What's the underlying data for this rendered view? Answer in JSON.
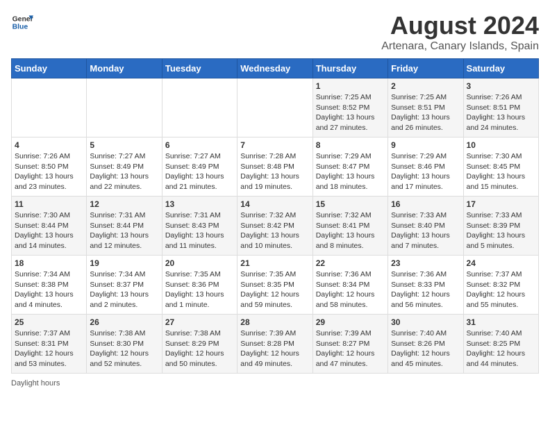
{
  "header": {
    "logo_general": "General",
    "logo_blue": "Blue",
    "main_title": "August 2024",
    "sub_title": "Artenara, Canary Islands, Spain"
  },
  "days_of_week": [
    "Sunday",
    "Monday",
    "Tuesday",
    "Wednesday",
    "Thursday",
    "Friday",
    "Saturday"
  ],
  "weeks": [
    [
      {
        "day": "",
        "info": ""
      },
      {
        "day": "",
        "info": ""
      },
      {
        "day": "",
        "info": ""
      },
      {
        "day": "",
        "info": ""
      },
      {
        "day": "1",
        "info": "Sunrise: 7:25 AM\nSunset: 8:52 PM\nDaylight: 13 hours\nand 27 minutes."
      },
      {
        "day": "2",
        "info": "Sunrise: 7:25 AM\nSunset: 8:51 PM\nDaylight: 13 hours\nand 26 minutes."
      },
      {
        "day": "3",
        "info": "Sunrise: 7:26 AM\nSunset: 8:51 PM\nDaylight: 13 hours\nand 24 minutes."
      }
    ],
    [
      {
        "day": "4",
        "info": "Sunrise: 7:26 AM\nSunset: 8:50 PM\nDaylight: 13 hours\nand 23 minutes."
      },
      {
        "day": "5",
        "info": "Sunrise: 7:27 AM\nSunset: 8:49 PM\nDaylight: 13 hours\nand 22 minutes."
      },
      {
        "day": "6",
        "info": "Sunrise: 7:27 AM\nSunset: 8:49 PM\nDaylight: 13 hours\nand 21 minutes."
      },
      {
        "day": "7",
        "info": "Sunrise: 7:28 AM\nSunset: 8:48 PM\nDaylight: 13 hours\nand 19 minutes."
      },
      {
        "day": "8",
        "info": "Sunrise: 7:29 AM\nSunset: 8:47 PM\nDaylight: 13 hours\nand 18 minutes."
      },
      {
        "day": "9",
        "info": "Sunrise: 7:29 AM\nSunset: 8:46 PM\nDaylight: 13 hours\nand 17 minutes."
      },
      {
        "day": "10",
        "info": "Sunrise: 7:30 AM\nSunset: 8:45 PM\nDaylight: 13 hours\nand 15 minutes."
      }
    ],
    [
      {
        "day": "11",
        "info": "Sunrise: 7:30 AM\nSunset: 8:44 PM\nDaylight: 13 hours\nand 14 minutes."
      },
      {
        "day": "12",
        "info": "Sunrise: 7:31 AM\nSunset: 8:44 PM\nDaylight: 13 hours\nand 12 minutes."
      },
      {
        "day": "13",
        "info": "Sunrise: 7:31 AM\nSunset: 8:43 PM\nDaylight: 13 hours\nand 11 minutes."
      },
      {
        "day": "14",
        "info": "Sunrise: 7:32 AM\nSunset: 8:42 PM\nDaylight: 13 hours\nand 10 minutes."
      },
      {
        "day": "15",
        "info": "Sunrise: 7:32 AM\nSunset: 8:41 PM\nDaylight: 13 hours\nand 8 minutes."
      },
      {
        "day": "16",
        "info": "Sunrise: 7:33 AM\nSunset: 8:40 PM\nDaylight: 13 hours\nand 7 minutes."
      },
      {
        "day": "17",
        "info": "Sunrise: 7:33 AM\nSunset: 8:39 PM\nDaylight: 13 hours\nand 5 minutes."
      }
    ],
    [
      {
        "day": "18",
        "info": "Sunrise: 7:34 AM\nSunset: 8:38 PM\nDaylight: 13 hours\nand 4 minutes."
      },
      {
        "day": "19",
        "info": "Sunrise: 7:34 AM\nSunset: 8:37 PM\nDaylight: 13 hours\nand 2 minutes."
      },
      {
        "day": "20",
        "info": "Sunrise: 7:35 AM\nSunset: 8:36 PM\nDaylight: 13 hours\nand 1 minute."
      },
      {
        "day": "21",
        "info": "Sunrise: 7:35 AM\nSunset: 8:35 PM\nDaylight: 12 hours\nand 59 minutes."
      },
      {
        "day": "22",
        "info": "Sunrise: 7:36 AM\nSunset: 8:34 PM\nDaylight: 12 hours\nand 58 minutes."
      },
      {
        "day": "23",
        "info": "Sunrise: 7:36 AM\nSunset: 8:33 PM\nDaylight: 12 hours\nand 56 minutes."
      },
      {
        "day": "24",
        "info": "Sunrise: 7:37 AM\nSunset: 8:32 PM\nDaylight: 12 hours\nand 55 minutes."
      }
    ],
    [
      {
        "day": "25",
        "info": "Sunrise: 7:37 AM\nSunset: 8:31 PM\nDaylight: 12 hours\nand 53 minutes."
      },
      {
        "day": "26",
        "info": "Sunrise: 7:38 AM\nSunset: 8:30 PM\nDaylight: 12 hours\nand 52 minutes."
      },
      {
        "day": "27",
        "info": "Sunrise: 7:38 AM\nSunset: 8:29 PM\nDaylight: 12 hours\nand 50 minutes."
      },
      {
        "day": "28",
        "info": "Sunrise: 7:39 AM\nSunset: 8:28 PM\nDaylight: 12 hours\nand 49 minutes."
      },
      {
        "day": "29",
        "info": "Sunrise: 7:39 AM\nSunset: 8:27 PM\nDaylight: 12 hours\nand 47 minutes."
      },
      {
        "day": "30",
        "info": "Sunrise: 7:40 AM\nSunset: 8:26 PM\nDaylight: 12 hours\nand 45 minutes."
      },
      {
        "day": "31",
        "info": "Sunrise: 7:40 AM\nSunset: 8:25 PM\nDaylight: 12 hours\nand 44 minutes."
      }
    ]
  ],
  "footer": {
    "daylight_label": "Daylight hours"
  }
}
